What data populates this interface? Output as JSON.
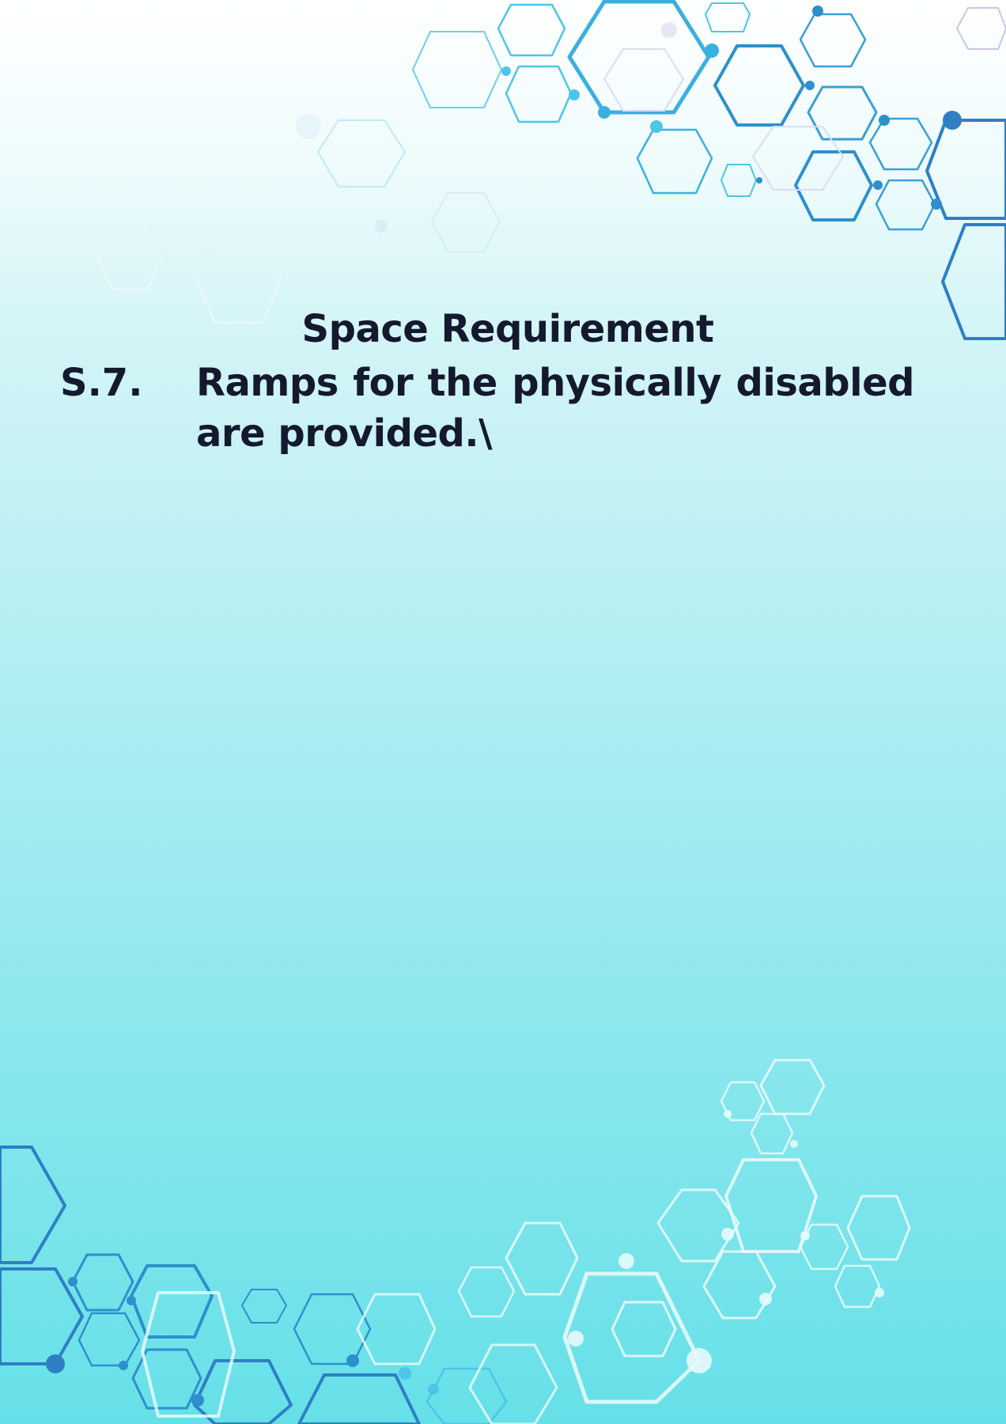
{
  "document": {
    "heading": "Space Requirement",
    "items": [
      {
        "number": "S.7.",
        "text": "Ramps for the physically disabled are provided.\\"
      }
    ]
  },
  "theme": {
    "text_color": "#14192e",
    "accent_blue": "#2a8fd4",
    "accent_cyan": "#4cc6e8"
  }
}
